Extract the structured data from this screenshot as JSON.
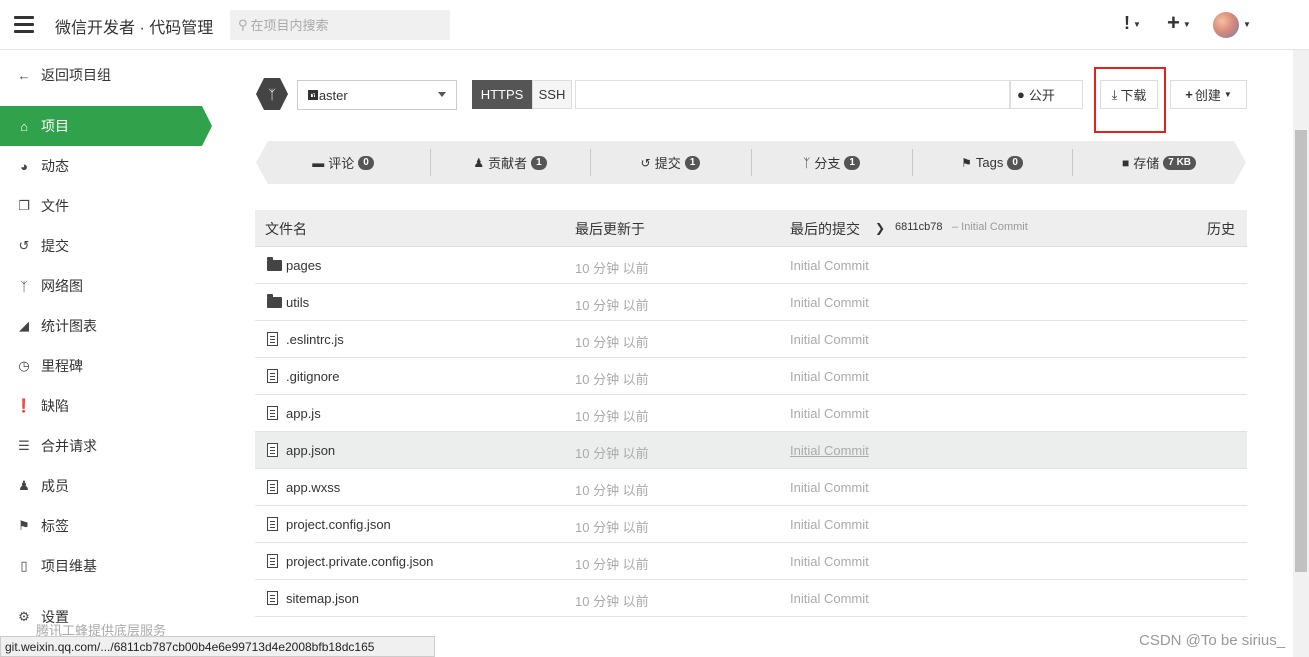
{
  "header": {
    "app_title": "微信开发者 · 代码管理",
    "search_placeholder": "在项目内搜索",
    "alerts_icon": "!",
    "create_icon": "+"
  },
  "sidebar": {
    "back_label": "返回项目组",
    "items": [
      {
        "icon": "home-icon",
        "label": "项目"
      },
      {
        "icon": "dashboard-icon",
        "label": "动态"
      },
      {
        "icon": "files-icon",
        "label": "文件"
      },
      {
        "icon": "history-icon",
        "label": "提交"
      },
      {
        "icon": "branch-icon",
        "label": "网络图"
      },
      {
        "icon": "area-chart-icon",
        "label": "统计图表"
      },
      {
        "icon": "clock-icon",
        "label": "里程碑"
      },
      {
        "icon": "exclamation-icon",
        "label": "缺陷"
      },
      {
        "icon": "list-icon",
        "label": "合并请求"
      },
      {
        "icon": "users-icon",
        "label": "成员"
      },
      {
        "icon": "tags-icon",
        "label": "标签"
      },
      {
        "icon": "book-icon",
        "label": "项目维基"
      },
      {
        "icon": "cogs-icon",
        "label": "设置"
      }
    ],
    "footer_note": "腾讯工蜂提供底层服务"
  },
  "repo": {
    "branch": "master",
    "https_label": "HTTPS",
    "ssh_label": "SSH",
    "public_label": "公开",
    "download_label": "下载",
    "create_label": "创建"
  },
  "stats": [
    {
      "icon": "comment-icon",
      "label": "评论",
      "count": "0"
    },
    {
      "icon": "user-icon",
      "label": "贡献者",
      "count": "1"
    },
    {
      "icon": "history-icon",
      "label": "提交",
      "count": "1"
    },
    {
      "icon": "branch-icon",
      "label": "分支",
      "count": "1"
    },
    {
      "icon": "tags-icon",
      "label": "Tags",
      "count": "0"
    },
    {
      "icon": "folder-icon",
      "label": "存储",
      "count": "7 KB"
    }
  ],
  "table": {
    "headers": {
      "name": "文件名",
      "updated": "最后更新于",
      "last_commit": "最后的提交",
      "commit_hash": "6811cb78",
      "commit_msg": "– Initial Commit",
      "history": "历史"
    },
    "rows": [
      {
        "type": "folder",
        "name": "pages",
        "updated": "10 分钟 以前",
        "commit": "Initial Commit"
      },
      {
        "type": "folder",
        "name": "utils",
        "updated": "10 分钟 以前",
        "commit": "Initial Commit"
      },
      {
        "type": "file",
        "name": ".eslintrc.js",
        "updated": "10 分钟 以前",
        "commit": "Initial Commit"
      },
      {
        "type": "file",
        "name": ".gitignore",
        "updated": "10 分钟 以前",
        "commit": "Initial Commit"
      },
      {
        "type": "file",
        "name": "app.js",
        "updated": "10 分钟 以前",
        "commit": "Initial Commit"
      },
      {
        "type": "file",
        "name": "app.json",
        "updated": "10 分钟 以前",
        "commit": "Initial Commit"
      },
      {
        "type": "file",
        "name": "app.wxss",
        "updated": "10 分钟 以前",
        "commit": "Initial Commit"
      },
      {
        "type": "file",
        "name": "project.config.json",
        "updated": "10 分钟 以前",
        "commit": "Initial Commit"
      },
      {
        "type": "file",
        "name": "project.private.config.json",
        "updated": "10 分钟 以前",
        "commit": "Initial Commit"
      },
      {
        "type": "file",
        "name": "sitemap.json",
        "updated": "10 分钟 以前",
        "commit": "Initial Commit"
      }
    ]
  },
  "status_url": "git.weixin.qq.com/.../6811cb787cb00b4e6e99713d4e2008bfb18dc165",
  "watermark": "CSDN @To be sirius_",
  "colors": {
    "active": "#2fa24b",
    "highlight": "#e2231a"
  }
}
